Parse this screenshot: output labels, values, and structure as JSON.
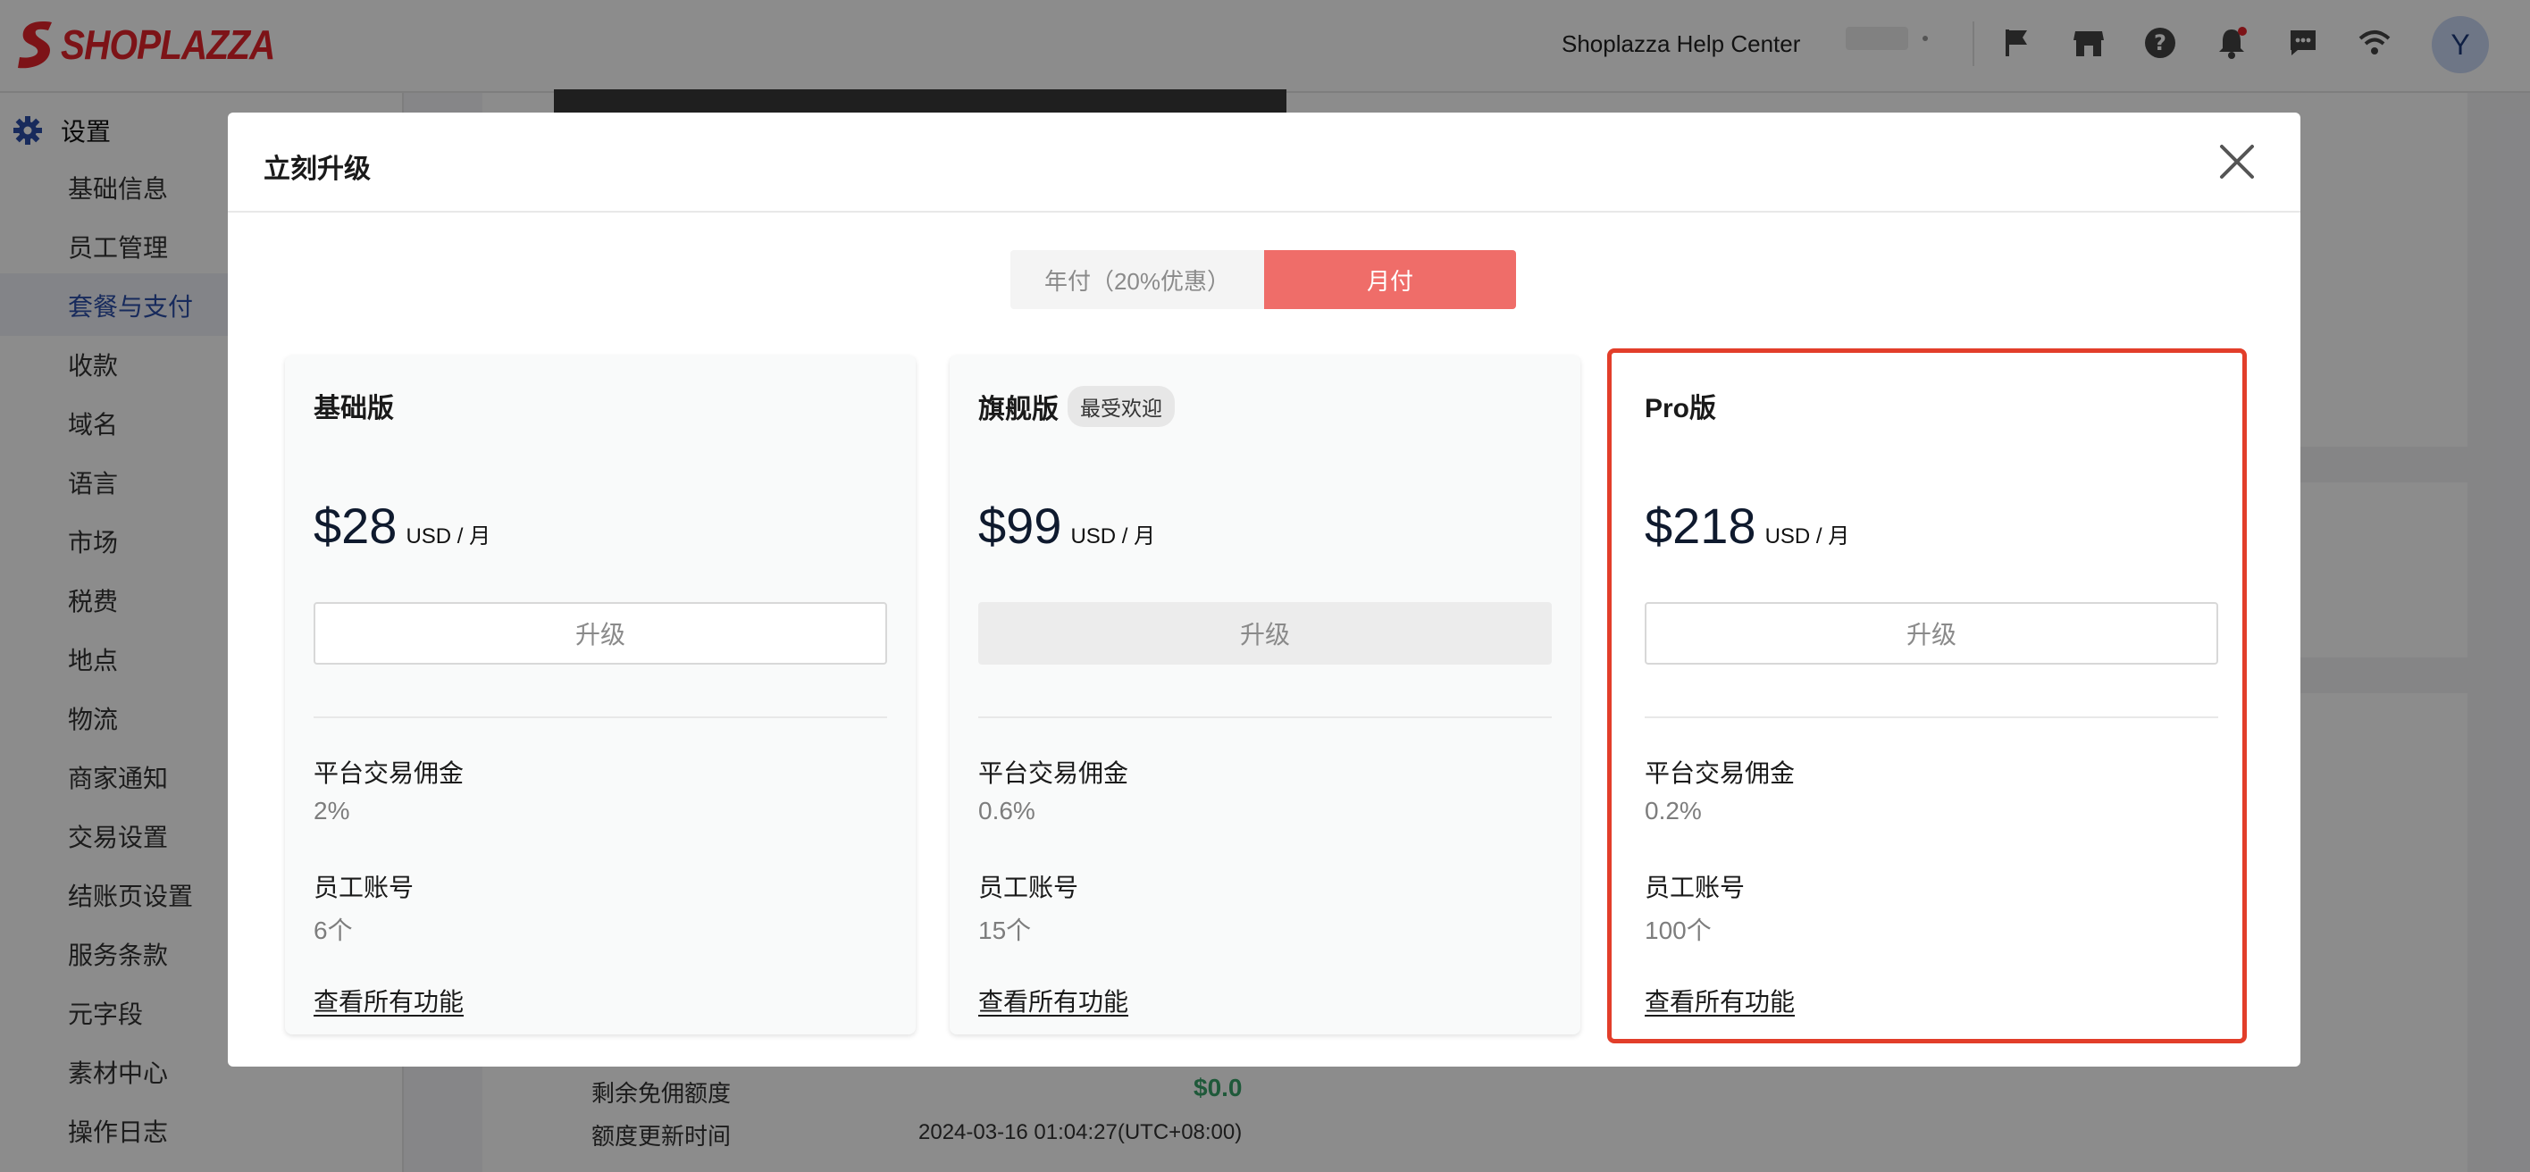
{
  "header": {
    "brand": "SHOPLAZZA",
    "help_center": "Shoplazza Help Center",
    "avatar_initial": "Y"
  },
  "sidebar": {
    "section_title": "设置",
    "items": [
      {
        "label": "基础信息"
      },
      {
        "label": "员工管理"
      },
      {
        "label": "套餐与支付",
        "active": true
      },
      {
        "label": "收款"
      },
      {
        "label": "域名"
      },
      {
        "label": "语言"
      },
      {
        "label": "市场"
      },
      {
        "label": "税费"
      },
      {
        "label": "地点"
      },
      {
        "label": "物流"
      },
      {
        "label": "商家通知"
      },
      {
        "label": "交易设置"
      },
      {
        "label": "结账页设置"
      },
      {
        "label": "服务条款"
      },
      {
        "label": "元字段"
      },
      {
        "label": "素材中心"
      },
      {
        "label": "操作日志"
      }
    ]
  },
  "background": {
    "remaining_label": "剩余免佣额度",
    "remaining_value": "$0.0",
    "updated_label": "额度更新时间",
    "updated_value": "2024-03-16 01:04:27(UTC+08:00)"
  },
  "modal": {
    "title": "立刻升级",
    "billing_toggle": {
      "yearly": "年付（20%优惠）",
      "monthly": "月付",
      "selected": "monthly"
    },
    "plans": [
      {
        "name": "基础版",
        "badge": "",
        "price": "$28",
        "unit": "USD / 月",
        "button": "升级",
        "commission_label": "平台交易佣金",
        "commission_value": "2%",
        "staff_label": "员工账号",
        "staff_value": "6个",
        "see_all": "查看所有功能"
      },
      {
        "name": "旗舰版",
        "badge": "最受欢迎",
        "price": "$99",
        "unit": "USD / 月",
        "button": "升级",
        "commission_label": "平台交易佣金",
        "commission_value": "0.6%",
        "staff_label": "员工账号",
        "staff_value": "15个",
        "see_all": "查看所有功能"
      },
      {
        "name": "Pro版",
        "badge": "",
        "price": "$218",
        "unit": "USD / 月",
        "button": "升级",
        "commission_label": "平台交易佣金",
        "commission_value": "0.2%",
        "staff_label": "员工账号",
        "staff_value": "100个",
        "see_all": "查看所有功能"
      }
    ]
  },
  "colors": {
    "brand_red": "#e3242b",
    "toggle_active": "#ef6d69",
    "highlight_border": "#e23e2a",
    "sidebar_active": "#2b4ea8",
    "positive_green": "#3aa36a"
  }
}
